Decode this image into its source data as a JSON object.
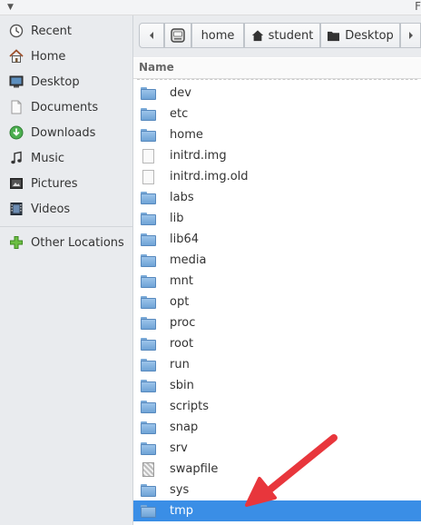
{
  "titlebar": {
    "cut_title": "F"
  },
  "sidebar": {
    "items": [
      {
        "label": "Recent",
        "icon": "clock-icon"
      },
      {
        "label": "Home",
        "icon": "home-icon"
      },
      {
        "label": "Desktop",
        "icon": "desktop-icon"
      },
      {
        "label": "Documents",
        "icon": "document-icon"
      },
      {
        "label": "Downloads",
        "icon": "download-icon"
      },
      {
        "label": "Music",
        "icon": "music-icon"
      },
      {
        "label": "Pictures",
        "icon": "pictures-icon"
      },
      {
        "label": "Videos",
        "icon": "video-icon"
      }
    ],
    "other_locations": {
      "label": "Other Locations",
      "icon": "plus-icon"
    }
  },
  "pathbar": {
    "segments": [
      "home",
      "student",
      "Desktop"
    ]
  },
  "list": {
    "column_name": "Name",
    "rows": [
      {
        "name": "dev",
        "type": "folder"
      },
      {
        "name": "etc",
        "type": "folder"
      },
      {
        "name": "home",
        "type": "folder"
      },
      {
        "name": "initrd.img",
        "type": "file"
      },
      {
        "name": "initrd.img.old",
        "type": "file"
      },
      {
        "name": "labs",
        "type": "folder"
      },
      {
        "name": "lib",
        "type": "folder"
      },
      {
        "name": "lib64",
        "type": "folder"
      },
      {
        "name": "media",
        "type": "folder"
      },
      {
        "name": "mnt",
        "type": "folder"
      },
      {
        "name": "opt",
        "type": "folder"
      },
      {
        "name": "proc",
        "type": "folder"
      },
      {
        "name": "root",
        "type": "folder"
      },
      {
        "name": "run",
        "type": "folder"
      },
      {
        "name": "sbin",
        "type": "folder"
      },
      {
        "name": "scripts",
        "type": "folder"
      },
      {
        "name": "snap",
        "type": "folder"
      },
      {
        "name": "srv",
        "type": "folder"
      },
      {
        "name": "swapfile",
        "type": "swap"
      },
      {
        "name": "sys",
        "type": "folder"
      },
      {
        "name": "tmp",
        "type": "folder",
        "selected": true
      }
    ]
  },
  "colors": {
    "selection": "#3a8ee6",
    "annotation_arrow": "#e8363c"
  }
}
